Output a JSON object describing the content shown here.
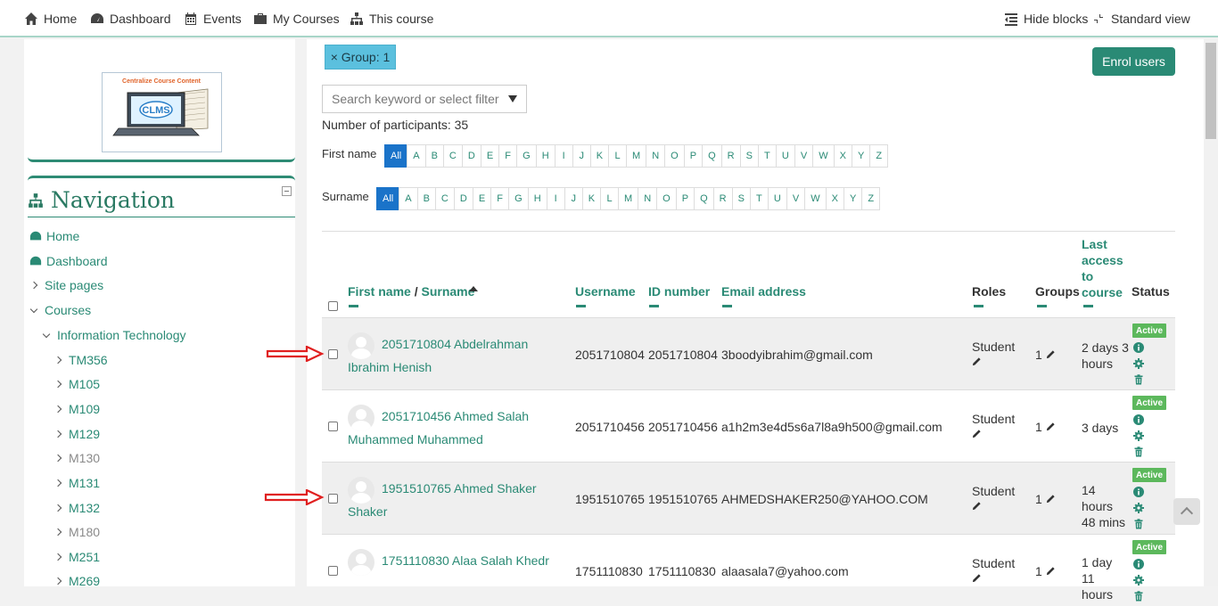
{
  "nav": {
    "home": "Home",
    "dashboard": "Dashboard",
    "events": "Events",
    "my_courses": "My Courses",
    "this_course": "This course",
    "hide_blocks": "Hide blocks",
    "standard_view": "Standard view"
  },
  "logo": {
    "title": "Centralize Course Content",
    "text": "CLMS"
  },
  "navigation": {
    "title": "Navigation",
    "items": [
      {
        "label": "Home"
      },
      {
        "label": "Dashboard"
      },
      {
        "label": "Site pages"
      },
      {
        "label": "Courses"
      },
      {
        "label": "Information Technology"
      },
      {
        "label": "TM356"
      },
      {
        "label": "M105"
      },
      {
        "label": "M109"
      },
      {
        "label": "M129"
      },
      {
        "label": "M130"
      },
      {
        "label": "M131"
      },
      {
        "label": "M132"
      },
      {
        "label": "M180"
      },
      {
        "label": "M251"
      },
      {
        "label": "M269"
      }
    ]
  },
  "filters": {
    "group_chip": "× Group: 1",
    "enrol_button": "Enrol users",
    "search_placeholder": "Search keyword or select filter",
    "participants_count": "Number of participants: 35",
    "first_name_label": "First name",
    "surname_label": "Surname",
    "letters": [
      "All",
      "A",
      "B",
      "C",
      "D",
      "E",
      "F",
      "G",
      "H",
      "I",
      "J",
      "K",
      "L",
      "M",
      "N",
      "O",
      "P",
      "Q",
      "R",
      "S",
      "T",
      "U",
      "V",
      "W",
      "X",
      "Y",
      "Z"
    ]
  },
  "table": {
    "headers": {
      "first_name": "First name",
      "separator": " / ",
      "surname": "Surname",
      "username": "Username",
      "id_number": "ID number",
      "email": "Email address",
      "roles": "Roles",
      "groups": "Groups",
      "last_access_1": "Last",
      "last_access_2": "access",
      "last_access_3": "to",
      "last_access_4": "course",
      "status": "Status"
    },
    "rows": [
      {
        "name1": "2051710804 Abdelrahman",
        "name2": "Ibrahim Henish",
        "username": "2051710804",
        "id": "2051710804",
        "email": "3boodyibrahim@gmail.com",
        "role": "Student",
        "groups": "1",
        "access1": "2 days 3",
        "access2": "hours",
        "access3": "",
        "status": "Active"
      },
      {
        "name1": "2051710456 Ahmed Salah",
        "name2": "Muhammed Muhammed",
        "username": "2051710456",
        "id": "2051710456",
        "email": "a1h2m3e4d5s6a7l8a9h500@gmail.com",
        "role": "Student",
        "groups": "1",
        "access1": "3 days",
        "access2": "",
        "access3": "",
        "status": "Active"
      },
      {
        "name1": "1951510765 Ahmed Shaker",
        "name2": "Shaker",
        "username": "1951510765",
        "id": "1951510765",
        "email": "AHMEDSHAKER250@YAHOO.COM",
        "role": "Student",
        "groups": "1",
        "access1": "14",
        "access2": "hours",
        "access3": "48 mins",
        "status": "Active"
      },
      {
        "name1": "1751110830 Alaa Salah Khedr",
        "name2": "",
        "username": "1751110830",
        "id": "1751110830",
        "email": "alaasala7@yahoo.com",
        "role": "Student",
        "groups": "1",
        "access1": "1 day",
        "access2": "11",
        "access3": "hours",
        "status": "Active"
      }
    ]
  },
  "colors": {
    "accent": "#2a8a75",
    "badge": "#5cb85c",
    "chip": "#5bc0de",
    "active_letter": "#1a73c9"
  }
}
